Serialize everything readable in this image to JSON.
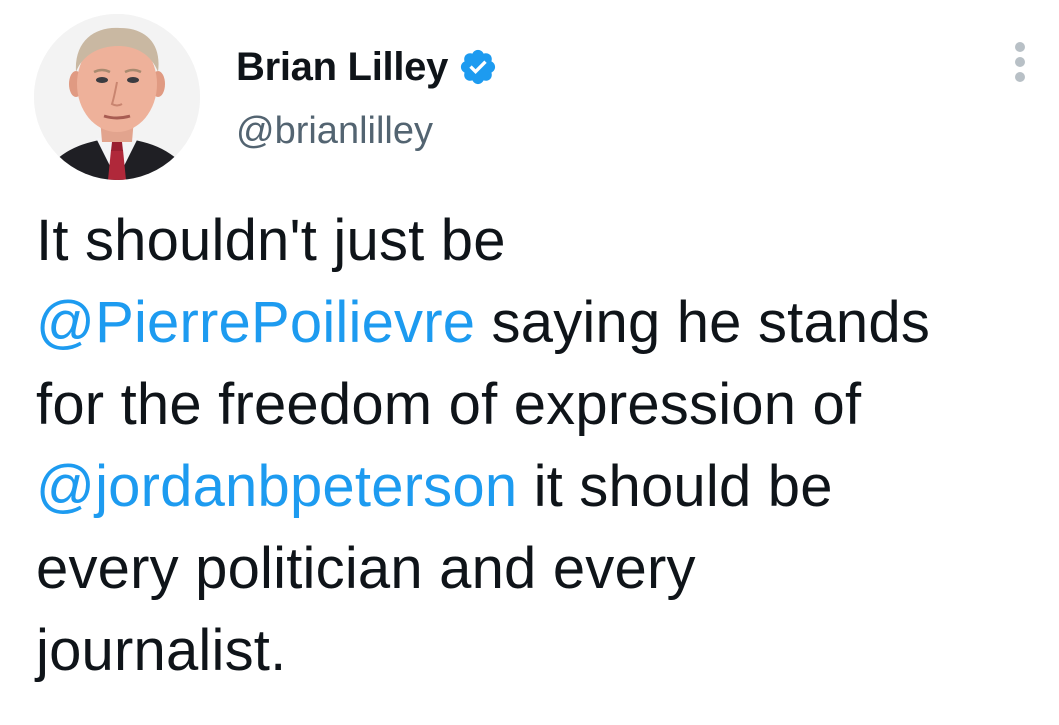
{
  "author": {
    "display_name": "Brian Lilley",
    "handle": "@brianlilley",
    "verified": true,
    "avatar_icon": "profile-photo",
    "verified_icon": "verified-badge-icon",
    "verified_color": "#1d9bf0"
  },
  "menu": {
    "icon": "more-options-icon"
  },
  "tweet": {
    "line1": "It shouldn't just be",
    "mention1": "@PierrePoilievre",
    "line2_rest": " saying he stands",
    "line3": "for the freedom of expression of",
    "mention2": "@jordanbpeterson",
    "line4_rest": " it should be",
    "line5": "every politician and every",
    "line6": "journalist."
  },
  "colors": {
    "text": "#0f1419",
    "secondary_text": "#536471",
    "link": "#1d9bf0",
    "background": "#ffffff"
  }
}
